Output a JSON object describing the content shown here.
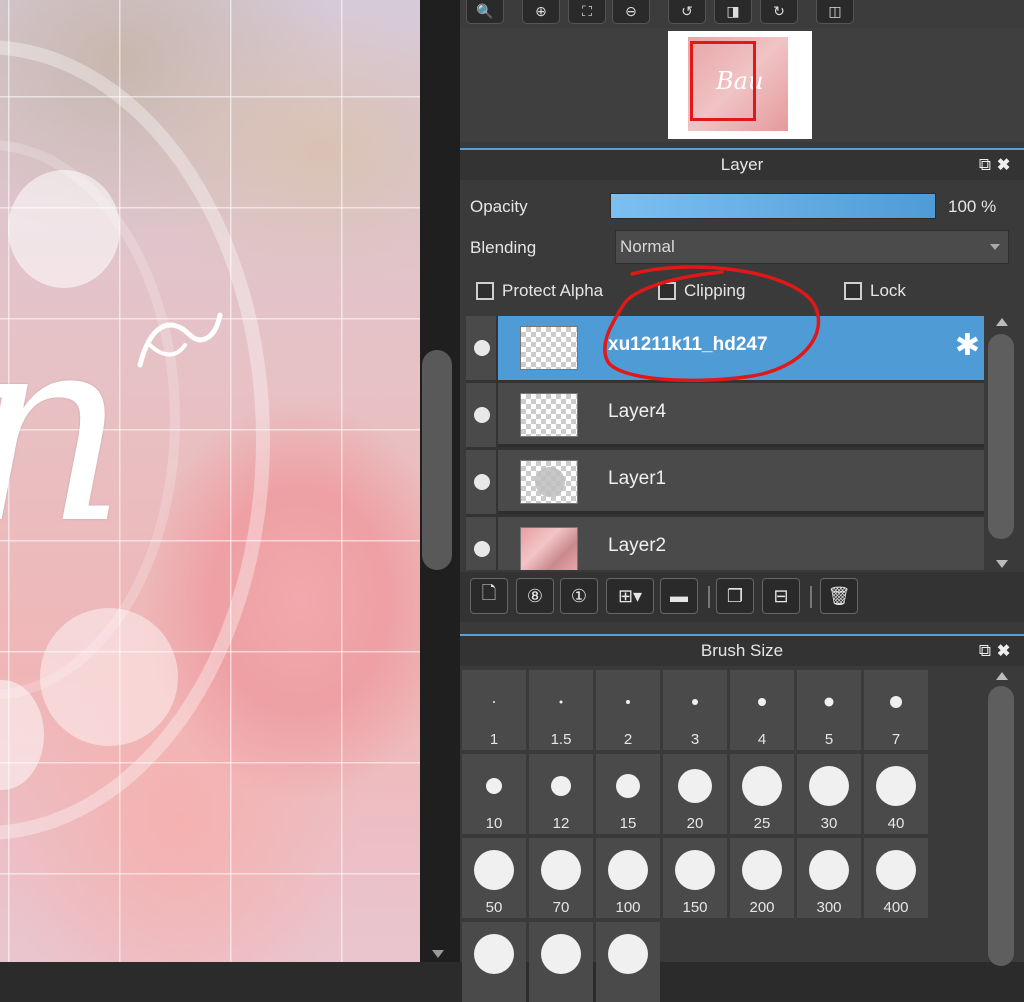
{
  "navigator": {
    "toolbar_icons": [
      "zoom-fit-icon",
      "zoom-in-icon",
      "fit-window-icon",
      "zoom-out-icon",
      "rotate-left-icon",
      "flip-icon",
      "rotate-right-icon",
      "split-view-icon"
    ],
    "thumb_text": "Bau"
  },
  "layer_panel": {
    "title": "Layer",
    "opacity_label": "Opacity",
    "opacity_value": "100 %",
    "opacity": 100,
    "blending_label": "Blending",
    "blending_value": "Normal",
    "protect_alpha_label": "Protect Alpha",
    "clipping_label": "Clipping",
    "lock_label": "Lock",
    "layers": [
      {
        "name": "xu1211k11_hd247",
        "active": true,
        "thumb": "transparent"
      },
      {
        "name": "Layer4",
        "active": false,
        "thumb": "transparent"
      },
      {
        "name": "Layer1",
        "active": false,
        "thumb": "blob"
      },
      {
        "name": "Layer2",
        "active": false,
        "thumb": "photo"
      }
    ],
    "toolbar_icons": [
      "new-layer-icon",
      "new-8bit-layer-icon",
      "new-1bit-layer-icon",
      "add-layer-menu-icon",
      "new-folder-icon",
      "duplicate-layer-icon",
      "merge-layer-icon",
      "delete-layer-icon"
    ]
  },
  "brush_panel": {
    "title": "Brush Size",
    "sizes": [
      {
        "label": "1",
        "d": 2
      },
      {
        "label": "1.5",
        "d": 3
      },
      {
        "label": "2",
        "d": 4
      },
      {
        "label": "3",
        "d": 6
      },
      {
        "label": "4",
        "d": 8
      },
      {
        "label": "5",
        "d": 9
      },
      {
        "label": "7",
        "d": 12
      },
      {
        "label": "10",
        "d": 16
      },
      {
        "label": "12",
        "d": 20
      },
      {
        "label": "15",
        "d": 24
      },
      {
        "label": "20",
        "d": 34
      },
      {
        "label": "25",
        "d": 40
      },
      {
        "label": "30",
        "d": 40
      },
      {
        "label": "40",
        "d": 40
      },
      {
        "label": "50",
        "d": 40
      },
      {
        "label": "70",
        "d": 40
      },
      {
        "label": "100",
        "d": 40
      },
      {
        "label": "150",
        "d": 40
      },
      {
        "label": "200",
        "d": 40
      },
      {
        "label": "300",
        "d": 40
      },
      {
        "label": "400",
        "d": 40
      },
      {
        "label": "",
        "d": 40
      },
      {
        "label": "",
        "d": 40
      },
      {
        "label": "",
        "d": 40
      }
    ]
  },
  "colors": {
    "accent": "#4f9bd6",
    "annotation": "#e01818"
  }
}
